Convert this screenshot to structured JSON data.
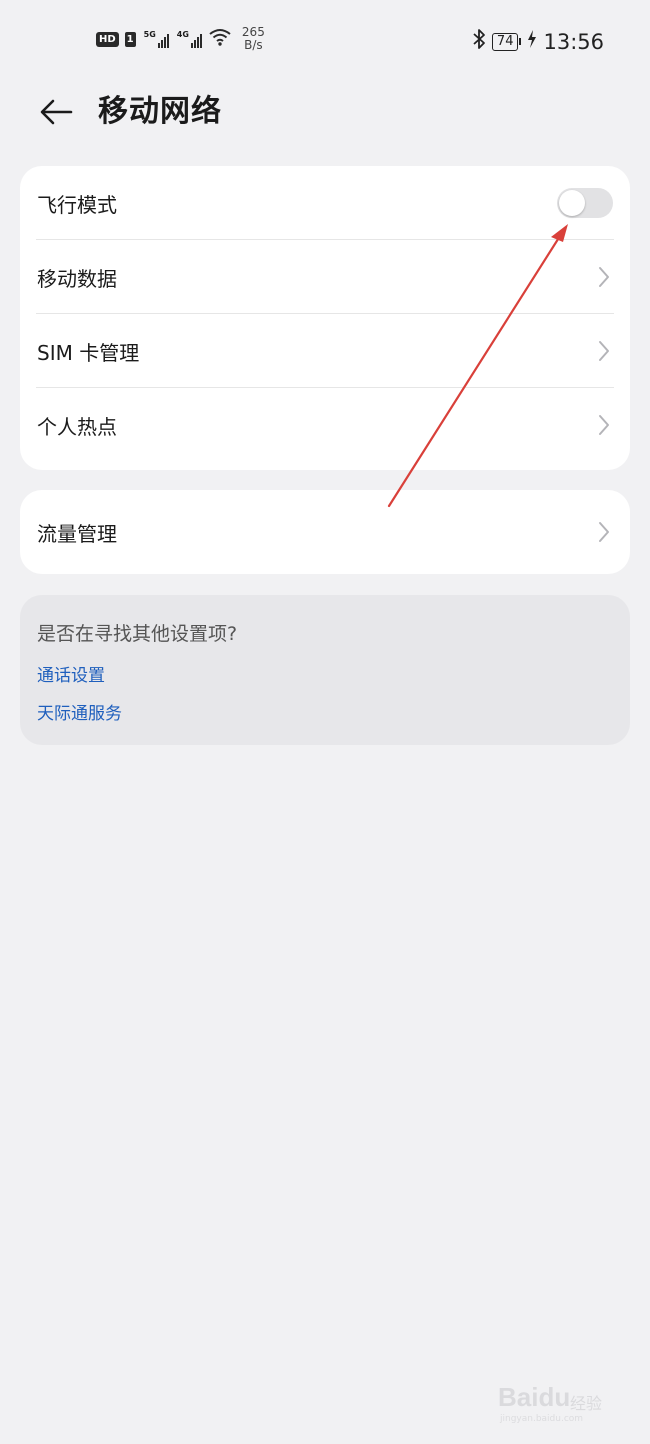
{
  "status_bar": {
    "hd_badge": "HD",
    "sim_badge": "1",
    "sim1_network": "5G",
    "sim2_network": "4G",
    "speed_value": "265",
    "speed_unit": "B/s",
    "battery_level": "74",
    "time": "13:56",
    "icons": [
      "hd-icon",
      "signal-5g-icon",
      "signal-4g-icon",
      "wifi-icon",
      "bluetooth-icon",
      "battery-icon",
      "charging-icon"
    ]
  },
  "header": {
    "title": "移动网络",
    "back_icon": "back-arrow-icon"
  },
  "network_card": {
    "items": [
      {
        "label": "飞行模式",
        "control": "toggle",
        "on": false
      },
      {
        "label": "移动数据",
        "control": "chevron"
      },
      {
        "label": "SIM 卡管理",
        "control": "chevron"
      },
      {
        "label": "个人热点",
        "control": "chevron"
      }
    ]
  },
  "traffic_card": {
    "label": "流量管理",
    "control": "chevron"
  },
  "suggestions": {
    "question": "是否在寻找其他设置项?",
    "links": [
      "通话设置",
      "天际通服务"
    ]
  },
  "annotation": {
    "color": "#d9403a"
  },
  "watermark": {
    "text": "Bai",
    "text2": "du",
    "sub": "经验",
    "url": "jingyan.baidu.com"
  },
  "colors": {
    "background": "#f1f1f3",
    "card": "#ffffff",
    "link": "#1f5fbd",
    "toggle_off": "#e2e2e4"
  }
}
